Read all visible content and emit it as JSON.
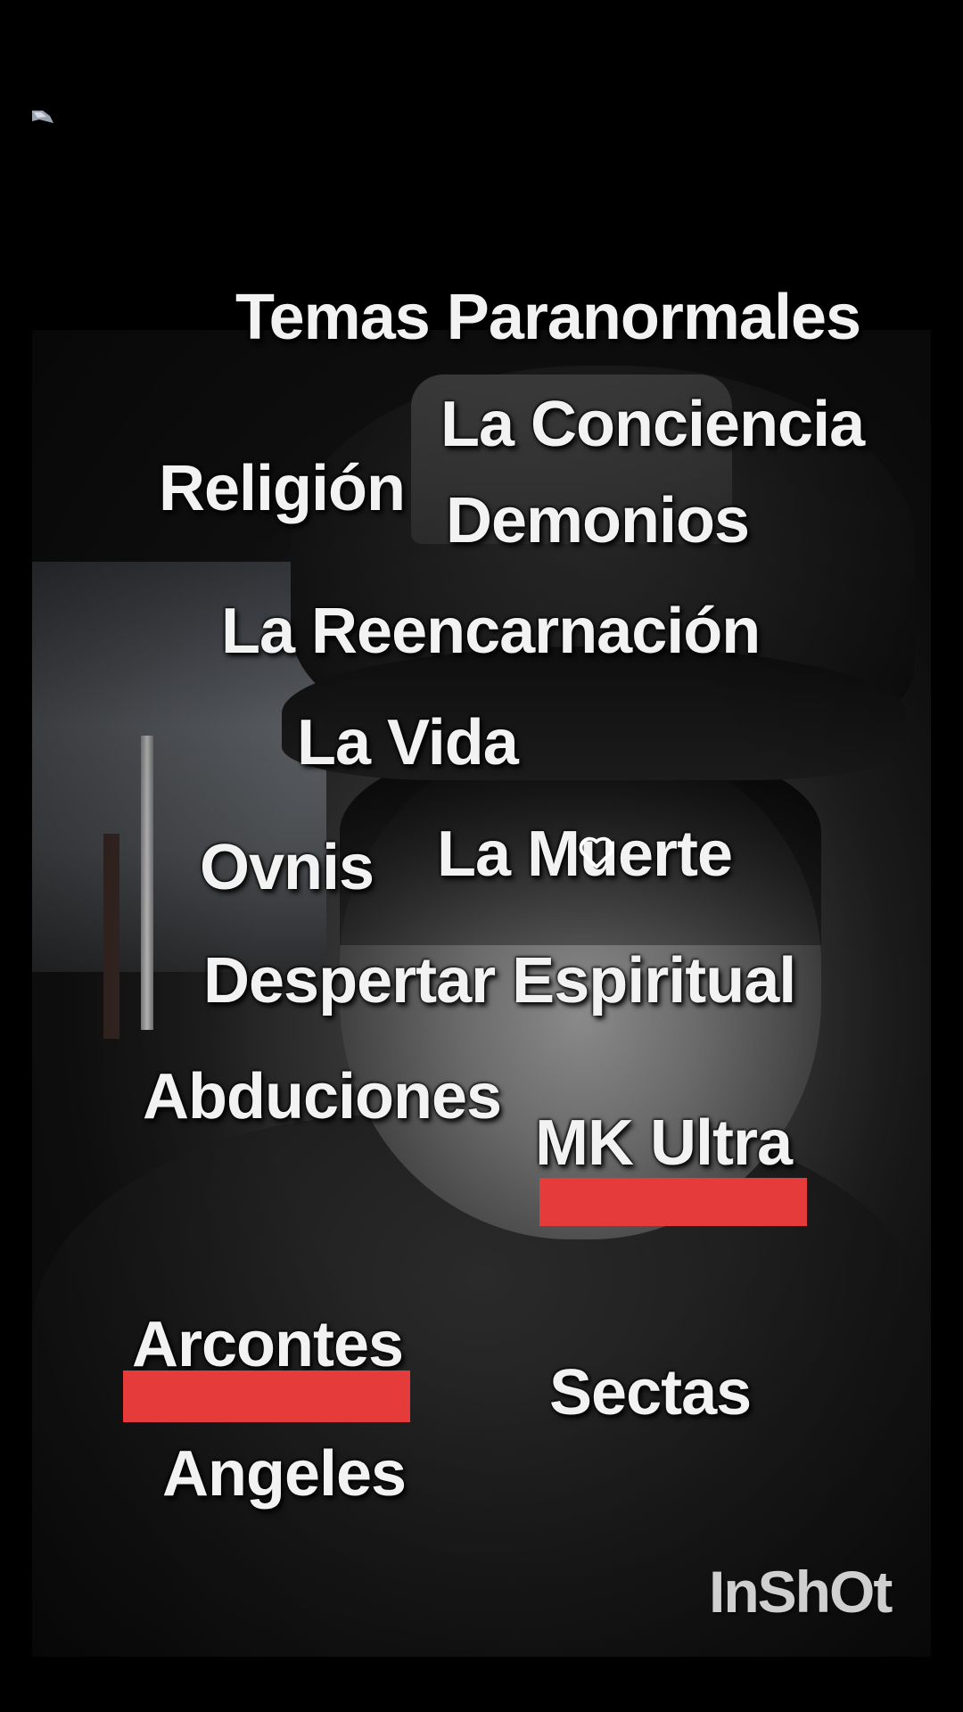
{
  "topics": [
    "Temas  Paranormales",
    "La Conciencia",
    "Religión",
    "Demonios",
    "La Reencarnación",
    "La Vida",
    "Ovnis",
    "La Muerte",
    "Despertar Espiritual",
    "Abduciones",
    "MK Ultra",
    "Arcontes",
    "Sectas",
    "Angeles"
  ],
  "highlight_color": "#e63b3b",
  "watermark": "InShOt",
  "icons": {
    "heart": "heart-outline-icon",
    "corner": "flag-icon"
  }
}
